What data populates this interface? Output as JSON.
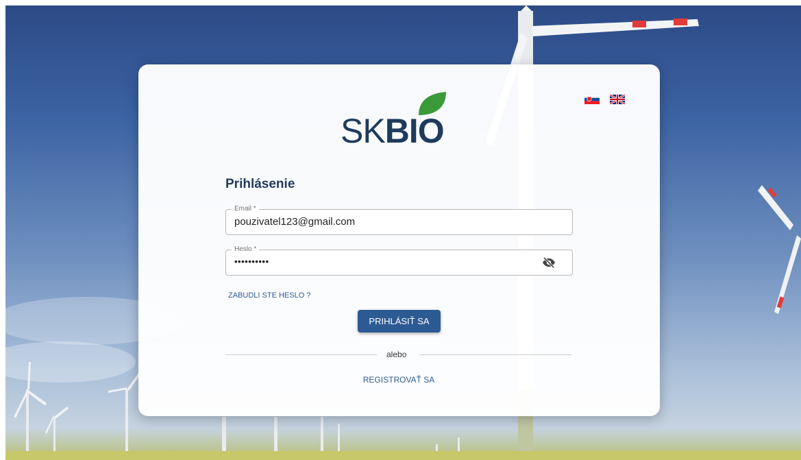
{
  "brand": {
    "logo_prefix": "SK",
    "logo_bold": "BIO",
    "leaf_color": "#3a9a3a",
    "text_color": "#1f3b5c"
  },
  "languages": [
    {
      "code": "sk",
      "icon": "slovak-flag-icon"
    },
    {
      "code": "en",
      "icon": "uk-flag-icon"
    }
  ],
  "login": {
    "title": "Prihlásenie",
    "email_label": "Email *",
    "email_value": "pouzivatel123@gmail.com",
    "password_label": "Heslo *",
    "password_value": "••••••••••",
    "toggle_icon": "eye-off-icon",
    "forgot_link": "ZABUDLI STE HESLO ?",
    "submit_label": "PRIHLÁSIŤ SA",
    "or_text": "alebo",
    "register_link": "REGISTROVAŤ SA"
  },
  "colors": {
    "primary": "#2c5a93",
    "link": "#2d5a8e"
  }
}
